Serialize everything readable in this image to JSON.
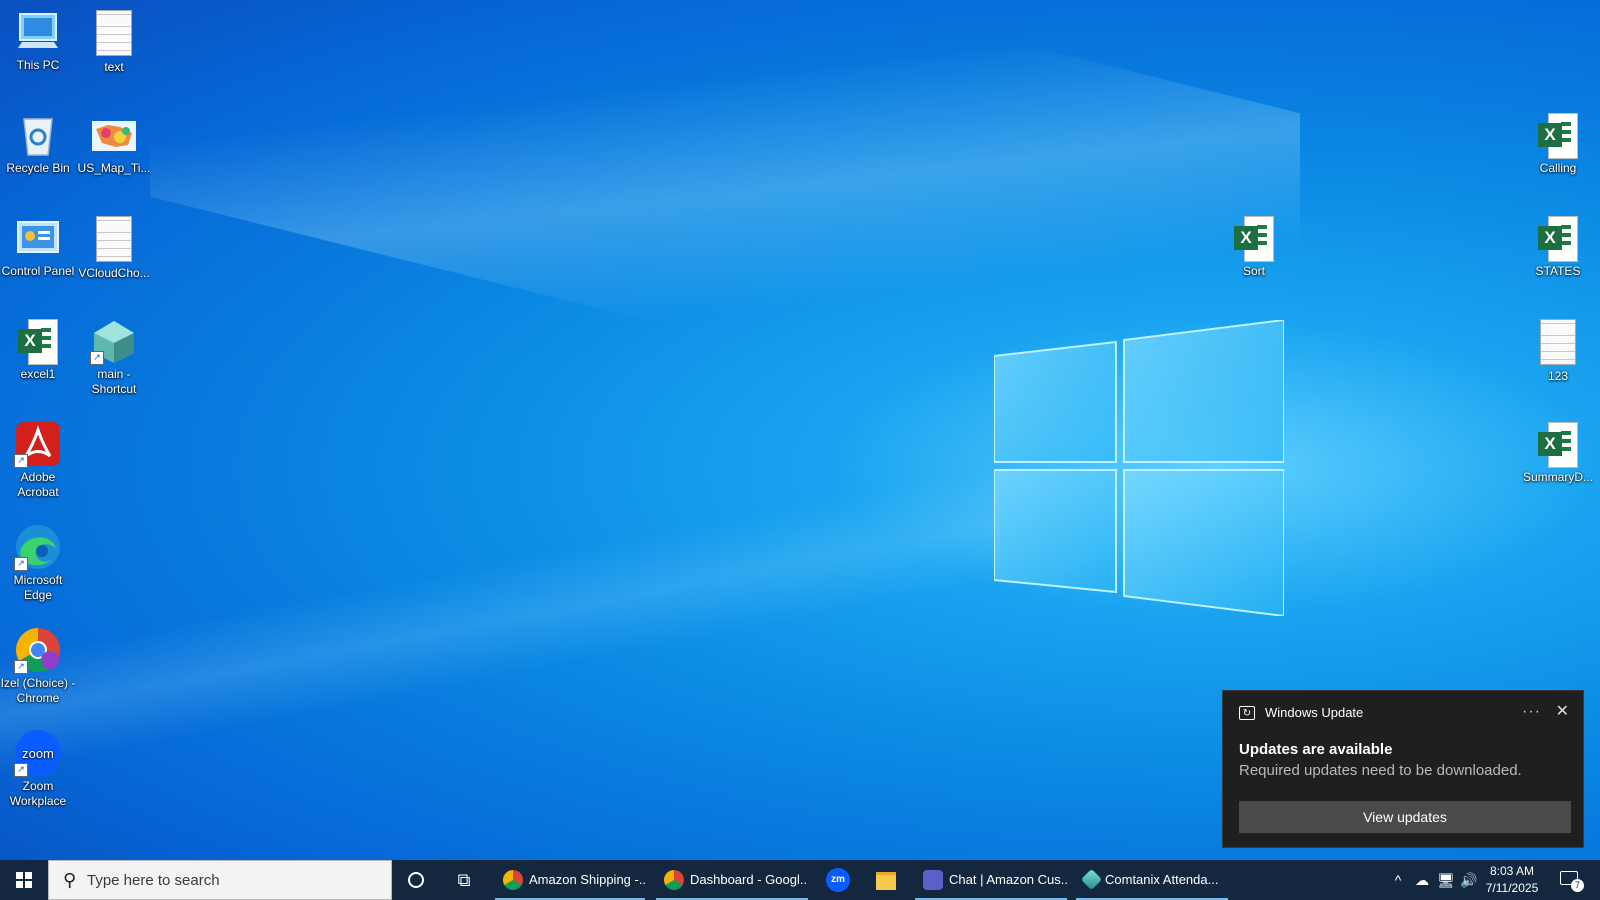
{
  "desktop": {
    "icons": [
      {
        "label": "This PC",
        "icon": "computer-icon"
      },
      {
        "label": "text",
        "icon": "text-file-icon"
      },
      {
        "label": "Recycle Bin",
        "icon": "recycle-bin-icon"
      },
      {
        "label": "US_Map_Ti...",
        "icon": "map-image-icon"
      },
      {
        "label": "Control Panel",
        "icon": "control-panel-icon"
      },
      {
        "label": "VCloudCho...",
        "icon": "text-file-icon"
      },
      {
        "label": "excel1",
        "icon": "excel-icon"
      },
      {
        "label": "main - Shortcut",
        "icon": "app-shortcut-icon"
      },
      {
        "label": "Adobe Acrobat",
        "icon": "acrobat-icon"
      },
      {
        "label": "Microsoft Edge",
        "icon": "edge-icon"
      },
      {
        "label": "Izel (Choice) - Chrome",
        "icon": "chrome-icon"
      },
      {
        "label": "Zoom Workplace",
        "icon": "zoom-icon"
      },
      {
        "label": "Sort",
        "icon": "excel-icon"
      },
      {
        "label": "Calling",
        "icon": "excel-icon"
      },
      {
        "label": "STATES",
        "icon": "excel-icon"
      },
      {
        "label": "123",
        "icon": "text-file-icon"
      },
      {
        "label": "SummaryD...",
        "icon": "excel-icon"
      }
    ],
    "excel_badge": "X",
    "zoom_badge": "zoom"
  },
  "notification": {
    "app": "Windows Update",
    "title": "Updates are available",
    "body": "Required updates need to be downloaded.",
    "button": "View updates",
    "more": "···",
    "close": "✕"
  },
  "taskbar": {
    "search_placeholder": "Type here to search",
    "tasks": [
      {
        "label": "Amazon Shipping -...",
        "icon": "chrome-icon"
      },
      {
        "label": "Dashboard - Googl...",
        "icon": "chrome-icon"
      },
      {
        "label": "Chat | Amazon Cus...",
        "icon": "teams-icon"
      },
      {
        "label": "Comtanix Attenda...",
        "icon": "comtanix-icon"
      }
    ],
    "zoom_label": "zm",
    "tray": {
      "chevron": "^",
      "time": "8:03 AM",
      "date": "7/11/2025",
      "notification_count": "7"
    }
  },
  "colors": {
    "taskbar": "#13283f",
    "toast_bg": "#1f1f1f",
    "toast_button": "#4a4a4a",
    "excel_green": "#1d6f42",
    "active_task_underline": "#76b9ed"
  }
}
